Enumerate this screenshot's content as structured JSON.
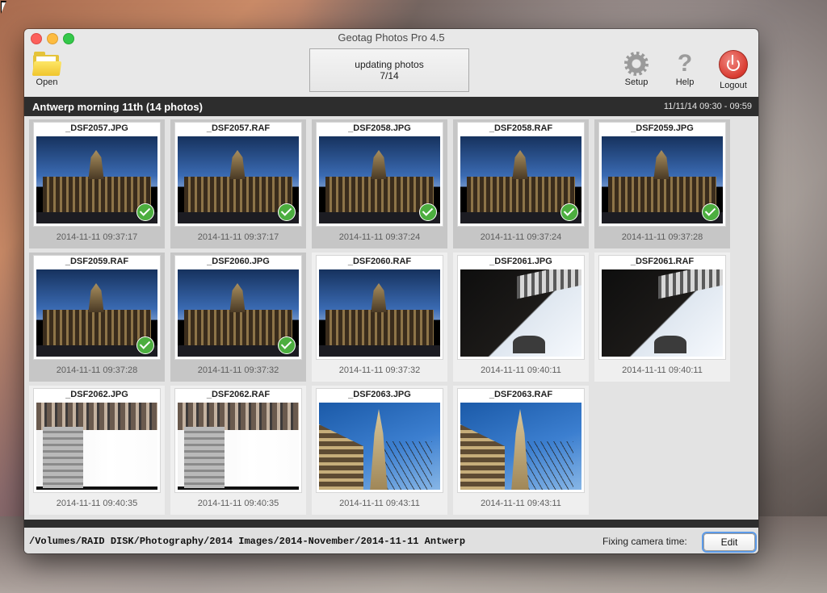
{
  "window": {
    "title": "Geotag Photos Pro 4.5"
  },
  "toolbar": {
    "open_label": "Open",
    "status_line1": "updating photos",
    "status_line2": "7/14",
    "setup_label": "Setup",
    "help_label": "Help",
    "logout_label": "Logout"
  },
  "group": {
    "title": "Antwerp morning 11th (14 photos)",
    "date_range": "11/11/14 09:30 - 09:59"
  },
  "photos": [
    {
      "name": "_DSF2057.JPG",
      "date": "2014-11-11 09:37:17",
      "done": true,
      "kind": "hall"
    },
    {
      "name": "_DSF2057.RAF",
      "date": "2014-11-11 09:37:17",
      "done": true,
      "kind": "hall"
    },
    {
      "name": "_DSF2058.JPG",
      "date": "2014-11-11 09:37:24",
      "done": true,
      "kind": "hall"
    },
    {
      "name": "_DSF2058.RAF",
      "date": "2014-11-11 09:37:24",
      "done": true,
      "kind": "hall"
    },
    {
      "name": "_DSF2059.JPG",
      "date": "2014-11-11 09:37:28",
      "done": true,
      "kind": "hall"
    },
    {
      "name": "_DSF2059.RAF",
      "date": "2014-11-11 09:37:28",
      "done": true,
      "kind": "hall"
    },
    {
      "name": "_DSF2060.JPG",
      "date": "2014-11-11 09:37:32",
      "done": true,
      "kind": "hall"
    },
    {
      "name": "_DSF2060.RAF",
      "date": "2014-11-11 09:37:32",
      "done": false,
      "kind": "hall"
    },
    {
      "name": "_DSF2061.JPG",
      "date": "2014-11-11 09:40:11",
      "done": false,
      "kind": "street"
    },
    {
      "name": "_DSF2061.RAF",
      "date": "2014-11-11 09:40:11",
      "done": false,
      "kind": "street"
    },
    {
      "name": "_DSF2062.JPG",
      "date": "2014-11-11 09:40:35",
      "done": false,
      "kind": "street2"
    },
    {
      "name": "_DSF2062.RAF",
      "date": "2014-11-11 09:40:35",
      "done": false,
      "kind": "street2"
    },
    {
      "name": "_DSF2063.JPG",
      "date": "2014-11-11 09:43:11",
      "done": false,
      "kind": "cathedral"
    },
    {
      "name": "_DSF2063.RAF",
      "date": "2014-11-11 09:43:11",
      "done": false,
      "kind": "cathedral"
    }
  ],
  "footer": {
    "path": "/Volumes/RAID DISK/Photography/2014 Images/2014-November/2014-11-11 Antwerp",
    "fixing_label": "Fixing camera time:",
    "edit_label": "Edit"
  },
  "colors": {
    "check": "#4cae3f",
    "logout": "#d93a30",
    "group_bar": "#2d2d2d"
  }
}
